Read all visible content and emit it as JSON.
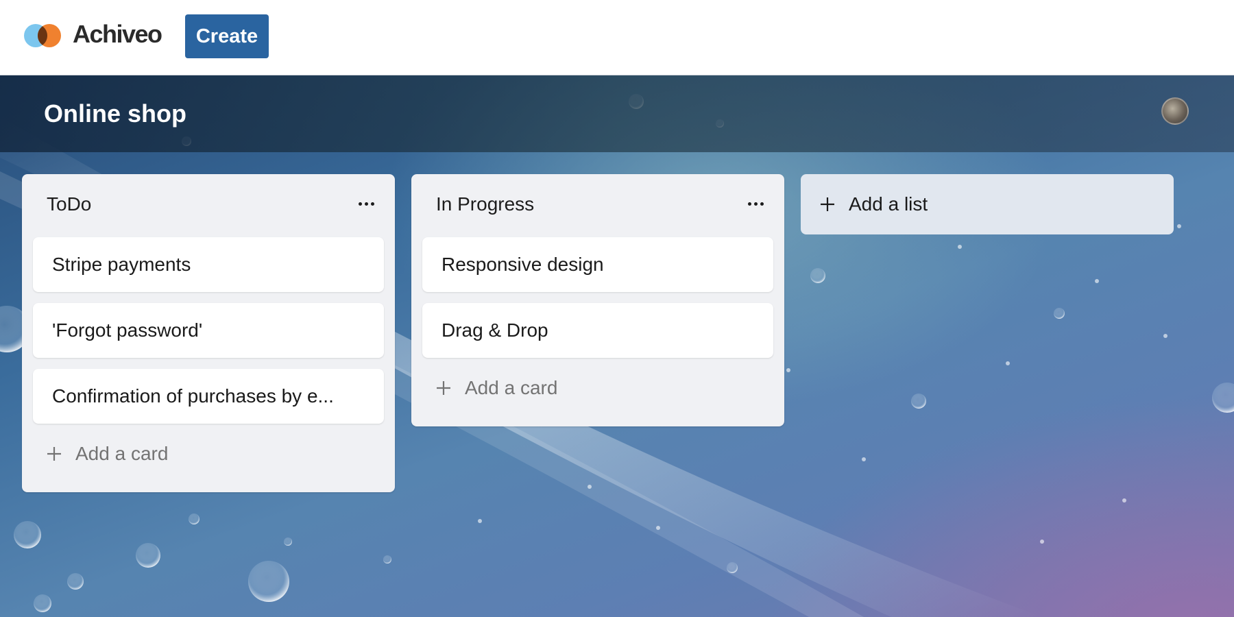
{
  "app": {
    "name": "Achiveo",
    "create_label": "Create",
    "colors": {
      "brand_button": "#2a64a0",
      "logo_blue": "#7cc6ee",
      "logo_orange": "#f0812f",
      "logo_overlap": "#6a3412"
    }
  },
  "board": {
    "title": "Online shop",
    "lists": [
      {
        "title": "ToDo",
        "cards": [
          "Stripe payments",
          "'Forgot password'",
          "Confirmation of purchases by e..."
        ],
        "add_card_label": "Add a card"
      },
      {
        "title": "In Progress",
        "cards": [
          "Responsive design",
          "Drag & Drop"
        ],
        "add_card_label": "Add a card"
      }
    ],
    "add_list_label": "Add a list"
  },
  "icons": {
    "logo": "achiveo-logo-icon",
    "list_menu": "more-horizontal-icon",
    "add": "plus-icon",
    "avatar": "avatar"
  }
}
